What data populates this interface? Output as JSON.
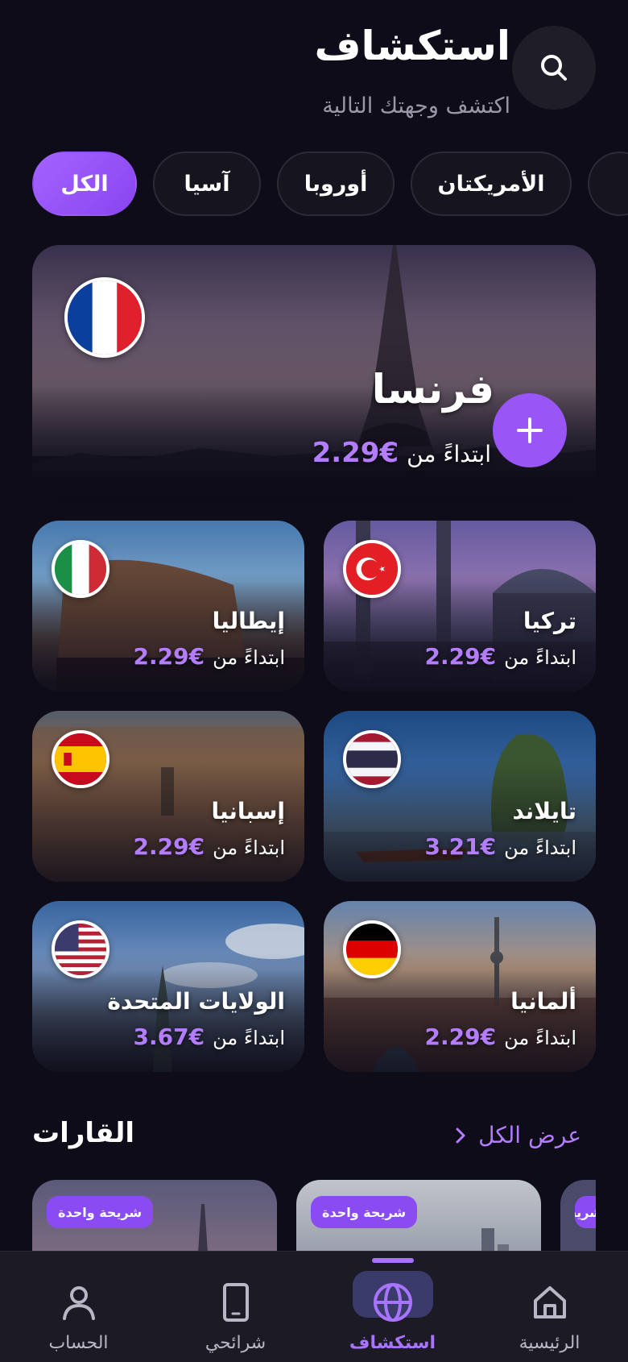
{
  "header": {
    "title": "استكشاف",
    "subtitle": "اكتشف وجهتك التالية",
    "search_icon": "search-icon"
  },
  "filters": {
    "chips": [
      {
        "label": "الكل",
        "active": true
      },
      {
        "label": "آسيا",
        "active": false
      },
      {
        "label": "أوروبا",
        "active": false
      },
      {
        "label": "الأمريكتان",
        "active": false
      }
    ]
  },
  "featured": {
    "country": "فرنسا",
    "from_label": "ابتداءً من",
    "price": "2.29€",
    "flag": "france-flag-icon",
    "action_icon": "plus-icon"
  },
  "destinations": [
    {
      "name": "تركيا",
      "from_label": "ابتداءً من",
      "price": "2.29€",
      "flag": "turkey-flag-icon"
    },
    {
      "name": "إيطاليا",
      "from_label": "ابتداءً من",
      "price": "2.29€",
      "flag": "italy-flag-icon"
    },
    {
      "name": "تايلاند",
      "from_label": "ابتداءً من",
      "price": "3.21€",
      "flag": "thailand-flag-icon"
    },
    {
      "name": "إسبانيا",
      "from_label": "ابتداءً من",
      "price": "2.29€",
      "flag": "spain-flag-icon"
    },
    {
      "name": "ألمانيا",
      "from_label": "ابتداءً من",
      "price": "2.29€",
      "flag": "germany-flag-icon"
    },
    {
      "name": "الولايات المتحدة",
      "from_label": "ابتداءً من",
      "price": "3.67€",
      "flag": "usa-flag-icon"
    }
  ],
  "regions": {
    "title": "القارات",
    "see_all": "عرض الكل",
    "badges": [
      "شريحة واحدة",
      "شريحة واحدة",
      "شريحة واحدة"
    ]
  },
  "nav": {
    "items": [
      {
        "label": "الرئيسية",
        "icon": "home-icon",
        "active": false
      },
      {
        "label": "استكشاف",
        "icon": "globe-icon",
        "active": true
      },
      {
        "label": "شرائحي",
        "icon": "phone-icon",
        "active": false
      },
      {
        "label": "الحساب",
        "icon": "user-icon",
        "active": false
      }
    ]
  },
  "colors": {
    "background": "#0d0c18",
    "accent": "#9a55f7",
    "price": "#b47cff"
  }
}
